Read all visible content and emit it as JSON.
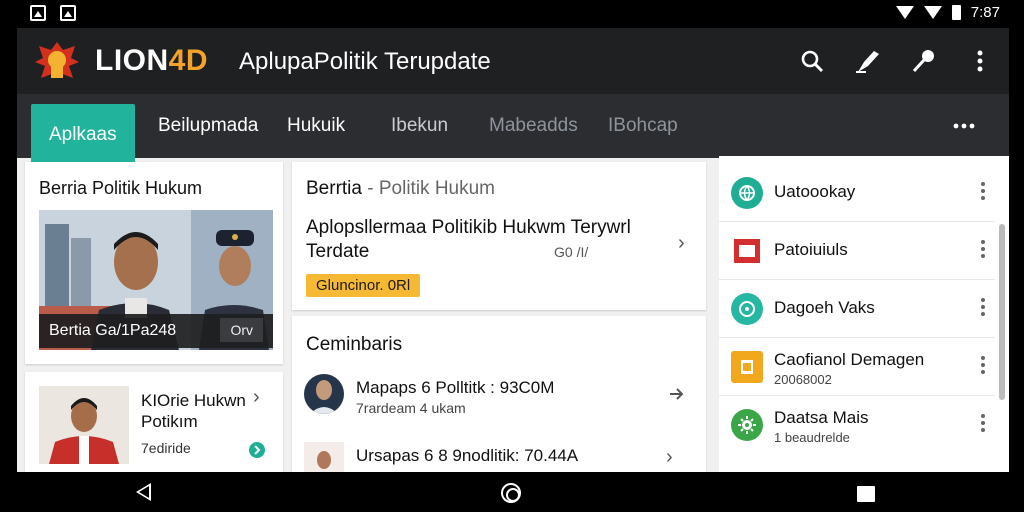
{
  "status_bar": {
    "time": "7:87"
  },
  "toolbar": {
    "brand_main": "LION",
    "brand_accent": "4D",
    "title": "AplupaPolitik Terupdate",
    "accent_color": "#f4a22a"
  },
  "tabs": [
    {
      "label": "Aplkaas",
      "active": true
    },
    {
      "label": "Beilupmada"
    },
    {
      "label": "Hukuik"
    },
    {
      "label": "Ibekun"
    },
    {
      "label": "Mabeadds"
    },
    {
      "label": "IBohcap"
    }
  ],
  "left_column": {
    "card_title": "Berria  Politik Hukum",
    "image_caption": "Bertia Ga/1Pa248",
    "caption_button": "Orv",
    "mini_card": {
      "title_line1": "KIOrie Hukwn",
      "title_line2": "Potikım",
      "subtitle": "7ediride"
    }
  },
  "middle_column": {
    "header_bold": "Berrtia",
    "header_sep": " - ",
    "header_thin": "Politik Hukum",
    "body": "Aplopsllermaa Politikib Hukwm Terywrl Terdate",
    "count": "G0 /I/",
    "badge": "Gluncinor. 0Rl",
    "section_title": "Ceminbaris",
    "rows": [
      {
        "title": "Mapaps 6 Polltitk : 93C0M",
        "subtitle": "7rardeam 4 ukam"
      },
      {
        "title": "Ursapas 6 8 9nodlitik: 70.44A",
        "subtitle": ""
      }
    ]
  },
  "right_column": {
    "items": [
      {
        "title": "Uatoookay",
        "subtitle": "",
        "icon": "globe-icon",
        "color": "#1fae94"
      },
      {
        "title": "Patoiuiuls",
        "subtitle": "",
        "icon": "folder-icon",
        "color": "#d32f2f"
      },
      {
        "title": "Dagoeh Vaks",
        "subtitle": "",
        "icon": "compass-icon",
        "color": "#26b7a2"
      },
      {
        "title": "Caofianol Demagen",
        "subtitle": "20068002",
        "icon": "document-icon",
        "color": "#f2a81d"
      },
      {
        "title": "Daatsa Mais",
        "subtitle": "1 beaudrelde",
        "icon": "gear-icon",
        "color": "#3aa648"
      }
    ]
  }
}
